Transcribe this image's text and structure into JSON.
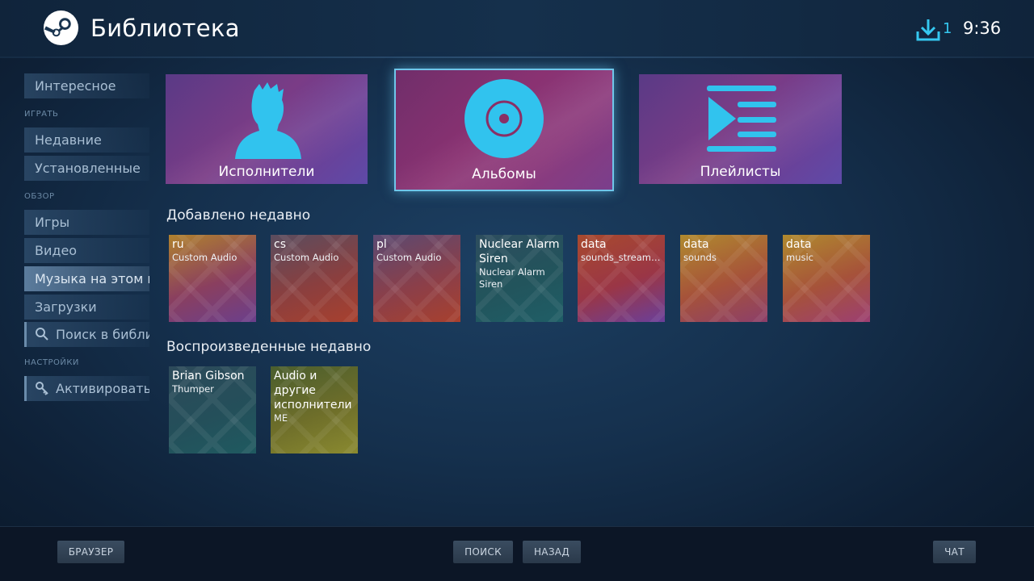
{
  "header": {
    "title": "Библиотека",
    "downloads_count": "1",
    "clock": "9:36"
  },
  "sidebar": {
    "items": [
      {
        "label": "Интересное"
      },
      {
        "label": "Недавние"
      },
      {
        "label": "Установленные"
      },
      {
        "label": "Игры"
      },
      {
        "label": "Видео"
      },
      {
        "label": "Музыка на этом компьютере"
      },
      {
        "label": "Загрузки"
      },
      {
        "label": "Поиск в библиотеке"
      },
      {
        "label": "Активировать"
      }
    ],
    "sections": {
      "play": "ИГРАТЬ",
      "browse": "ОБЗОР",
      "settings": "НАСТРОЙКИ"
    }
  },
  "categories": [
    {
      "label": "Исполнители",
      "icon": "person-icon"
    },
    {
      "label": "Альбомы",
      "icon": "disc-icon"
    },
    {
      "label": "Плейлисты",
      "icon": "playlist-icon"
    }
  ],
  "recently_added": {
    "title": "Добавлено недавно",
    "items": [
      {
        "title": "ru",
        "subtitle": "Custom Audio",
        "colors": [
          "#b0822e",
          "#8a3f5f",
          "#6b3f8c"
        ]
      },
      {
        "title": "cs",
        "subtitle": "Custom Audio",
        "colors": [
          "#5a4d5f",
          "#8a3f3f",
          "#a8402e"
        ]
      },
      {
        "title": "pl",
        "subtitle": "Custom Audio",
        "colors": [
          "#5a4a72",
          "#8a3f4a",
          "#a8402e"
        ]
      },
      {
        "title": "Nuclear Alarm Siren",
        "subtitle": "Nuclear Alarm Siren",
        "colors": [
          "#2d4d5e",
          "#22545c",
          "#1f5e66"
        ]
      },
      {
        "title": "data",
        "subtitle": "sounds_streamed",
        "colors": [
          "#a84a2e",
          "#9a3646",
          "#6a3f9a"
        ]
      },
      {
        "title": "data",
        "subtitle": "sounds",
        "colors": [
          "#b08a2e",
          "#a6523a",
          "#8c3f6a"
        ]
      },
      {
        "title": "data",
        "subtitle": "music",
        "colors": [
          "#b08a2e",
          "#a6523a",
          "#9c3f72"
        ]
      }
    ]
  },
  "recently_played": {
    "title": "Воспроизведенные недавно",
    "items": [
      {
        "title": "Brian Gibson",
        "subtitle": "Thumper",
        "colors": [
          "#2d4a5a",
          "#244f5a",
          "#1f5a60"
        ]
      },
      {
        "title": "Audio и другие исполнители",
        "subtitle": "ME",
        "colors": [
          "#4a5e2e",
          "#6e6e2a",
          "#8a8a30"
        ]
      }
    ]
  },
  "footer": {
    "browser": "БРАУЗЕР",
    "search": "ПОИСК",
    "back": "НАЗАД",
    "chat": "ЧАТ"
  }
}
